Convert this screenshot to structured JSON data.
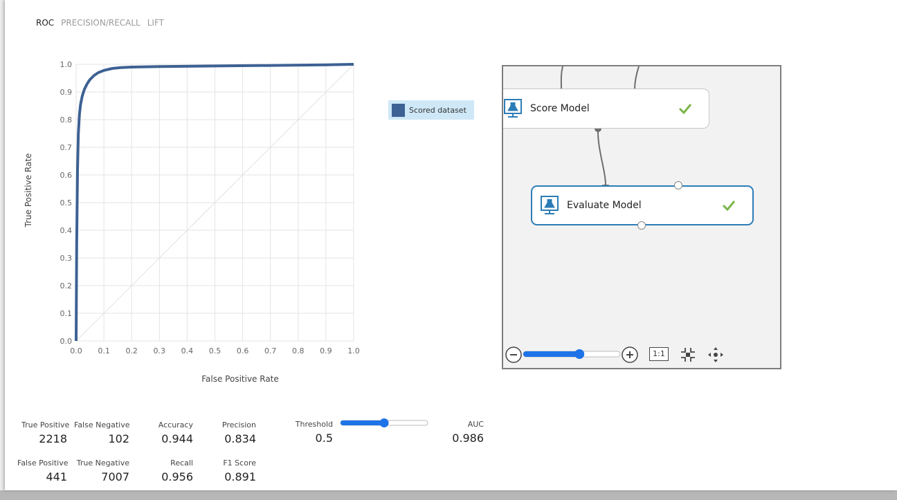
{
  "tabs": [
    {
      "label": "ROC",
      "active": true
    },
    {
      "label": "PRECISION/RECALL",
      "active": false
    },
    {
      "label": "LIFT",
      "active": false
    }
  ],
  "chart_data": {
    "type": "line",
    "xlabel": "False Positive Rate",
    "ylabel": "True Positive Rate",
    "xlim": [
      0,
      1
    ],
    "ylim": [
      0,
      1
    ],
    "ticks": [
      "0.0",
      "0.1",
      "0.2",
      "0.3",
      "0.4",
      "0.5",
      "0.6",
      "0.7",
      "0.8",
      "0.9",
      "1.0"
    ],
    "grid": true,
    "legend_position": "right",
    "series": [
      {
        "name": "Scored dataset",
        "color": "#3d6193",
        "x": [
          0,
          0.002,
          0.005,
          0.008,
          0.012,
          0.016,
          0.022,
          0.03,
          0.04,
          0.05,
          0.065,
          0.08,
          0.1,
          0.13,
          0.16,
          0.2,
          0.3,
          0.5,
          0.7,
          0.9,
          1.0
        ],
        "y": [
          0,
          0.35,
          0.62,
          0.75,
          0.82,
          0.855,
          0.885,
          0.91,
          0.93,
          0.945,
          0.96,
          0.97,
          0.978,
          0.985,
          0.988,
          0.99,
          0.992,
          0.994,
          0.996,
          0.998,
          1.0
        ]
      }
    ],
    "baseline": {
      "x": [
        0,
        1
      ],
      "y": [
        0,
        1
      ],
      "color": "#e2e2e2"
    }
  },
  "metrics": {
    "true_positive": {
      "label": "True Positive",
      "value": "2218"
    },
    "false_negative": {
      "label": "False Negative",
      "value": "102"
    },
    "accuracy": {
      "label": "Accuracy",
      "value": "0.944"
    },
    "precision": {
      "label": "Precision",
      "value": "0.834"
    },
    "threshold": {
      "label": "Threshold",
      "value": "0.5",
      "slider_fraction": 0.5
    },
    "auc": {
      "label": "AUC",
      "value": "0.986"
    },
    "false_positive": {
      "label": "False Positive",
      "value": "441"
    },
    "true_negative": {
      "label": "True Negative",
      "value": "7007"
    },
    "recall": {
      "label": "Recall",
      "value": "0.956"
    },
    "f1": {
      "label": "F1 Score",
      "value": "0.891"
    }
  },
  "experiment": {
    "modules": [
      {
        "name": "Score Model",
        "status": "done",
        "selected": false
      },
      {
        "name": "Evaluate Model",
        "status": "done",
        "selected": true
      }
    ],
    "zoom": {
      "fit_label": "1:1",
      "zoom_fraction": 0.58
    },
    "accent": "#2b7cb6",
    "check_color": "#7ab648"
  }
}
